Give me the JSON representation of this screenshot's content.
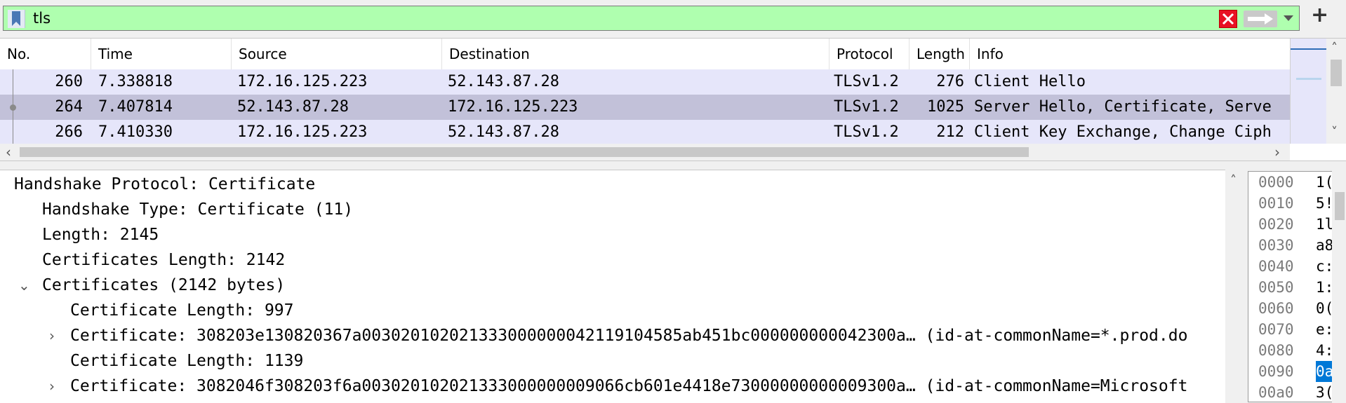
{
  "filter": {
    "value": "tls",
    "bookmark_icon": "bookmark-icon",
    "clear_icon": "close-icon",
    "apply_icon": "arrow-right-icon",
    "dropdown_icon": "chevron-down-icon",
    "add_label": "+"
  },
  "colors": {
    "filter_valid_bg": "#afffaf",
    "row_bg": "#e6e6fa",
    "row_selected_bg": "#c2c1d9",
    "hex_selection": "#0078d7"
  },
  "packet_list": {
    "columns": [
      "No.",
      "Time",
      "Source",
      "Destination",
      "Protocol",
      "Length",
      "Info"
    ],
    "rows": [
      {
        "no": "260",
        "time": "7.338818",
        "source": "172.16.125.223",
        "destination": "52.143.87.28",
        "protocol": "TLSv1.2",
        "length": "276",
        "info": "Client Hello"
      },
      {
        "no": "264",
        "time": "7.407814",
        "source": "52.143.87.28",
        "destination": "172.16.125.223",
        "protocol": "TLSv1.2",
        "length": "1025",
        "info": "Server Hello, Certificate, Serve"
      },
      {
        "no": "266",
        "time": "7.410330",
        "source": "172.16.125.223",
        "destination": "52.143.87.28",
        "protocol": "TLSv1.2",
        "length": "212",
        "info": "Client Key Exchange, Change Ciph"
      }
    ]
  },
  "details": {
    "lines": [
      "Handshake Protocol: Certificate",
      "Handshake Type: Certificate (11)",
      "Length: 2145",
      "Certificates Length: 2142",
      "Certificates (2142 bytes)",
      "Certificate Length: 997",
      "Certificate: 308203e130820367a003020102021333000000042119104585ab451bc000000000042300a… (id-at-commonName=*.prod.do",
      "Certificate Length: 1139",
      "Certificate: 3082046f308203f6a003020102021333000000009066cb601e4418e73000000000009300a… (id-at-commonName=Microsoft"
    ]
  },
  "hex": {
    "rows": [
      {
        "offset": "0000",
        "byte": "1("
      },
      {
        "offset": "0010",
        "byte": "5!"
      },
      {
        "offset": "0020",
        "byte": "1l"
      },
      {
        "offset": "0030",
        "byte": "a8"
      },
      {
        "offset": "0040",
        "byte": "c:"
      },
      {
        "offset": "0050",
        "byte": "1:"
      },
      {
        "offset": "0060",
        "byte": "0("
      },
      {
        "offset": "0070",
        "byte": "e:"
      },
      {
        "offset": "0080",
        "byte": "4:"
      },
      {
        "offset": "0090",
        "byte": "0a"
      },
      {
        "offset": "00a0",
        "byte": "3("
      }
    ]
  }
}
